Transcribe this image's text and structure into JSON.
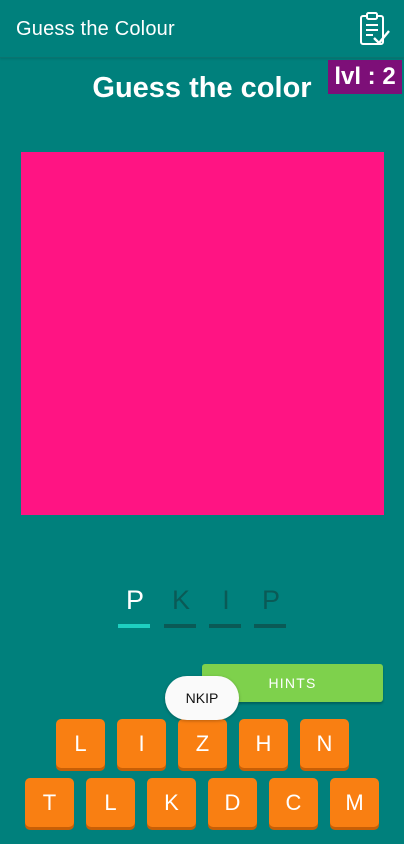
{
  "app_title": "Guess the Colour",
  "level_label": "lvl : 2",
  "heading": "Guess the color",
  "target_color": "#ff1483",
  "answer_slots": [
    {
      "letter": "P",
      "state": "filled"
    },
    {
      "letter": "K",
      "state": "hint"
    },
    {
      "letter": "I",
      "state": "hint"
    },
    {
      "letter": "P",
      "state": "hint"
    }
  ],
  "hints_label": "HINTS",
  "toast_text": "NKIP",
  "keyboard": {
    "row1": [
      "L",
      "I",
      "Z",
      "H",
      "N"
    ],
    "row2": [
      "T",
      "L",
      "K",
      "D",
      "C",
      "M"
    ]
  },
  "colors": {
    "background": "#00807c",
    "level_badge": "#7d0f78",
    "hints_button": "#7ed14c",
    "key": "#f97f12",
    "slot_active": "#1ecfc0",
    "slot_inactive": "#0a5a56"
  }
}
